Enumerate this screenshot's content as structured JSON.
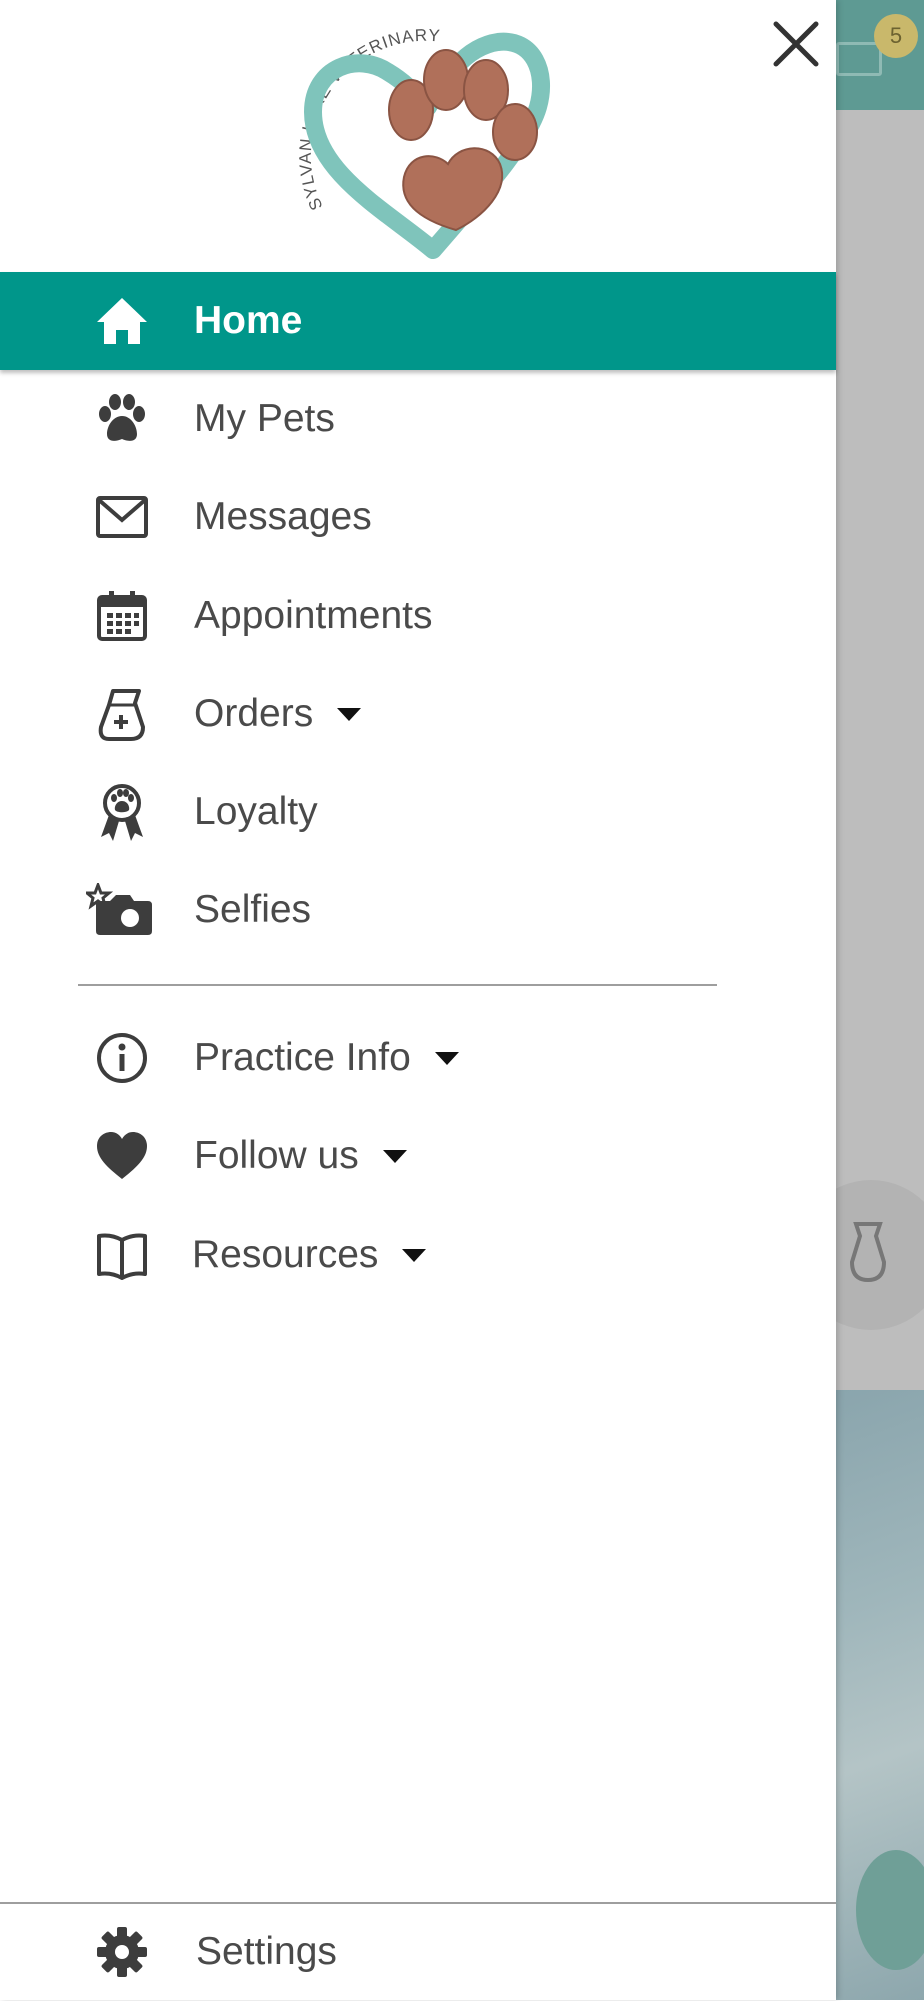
{
  "clinic": {
    "name": "SYLVAN LAKE VETERINARY CLINIC",
    "colors": {
      "teal": "#00968a",
      "heart": "#7fc4bb",
      "paw": "#b0705a"
    }
  },
  "header": {
    "close_icon": "close-icon"
  },
  "menu": {
    "primary": [
      {
        "label": "Home",
        "icon": "home-icon",
        "active": true
      },
      {
        "label": "My Pets",
        "icon": "paw-icon"
      },
      {
        "label": "Messages",
        "icon": "envelope-icon"
      },
      {
        "label": "Appointments",
        "icon": "calendar-icon"
      },
      {
        "label": "Orders",
        "icon": "medicine-bag-icon",
        "has_dropdown": true
      },
      {
        "label": "Loyalty",
        "icon": "award-ribbon-icon"
      },
      {
        "label": "Selfies",
        "icon": "camera-star-icon"
      }
    ],
    "secondary": [
      {
        "label": "Practice Info",
        "icon": "info-icon",
        "has_dropdown": true
      },
      {
        "label": "Follow us",
        "icon": "heart-icon",
        "has_dropdown": true
      },
      {
        "label": "Resources",
        "icon": "book-icon",
        "has_dropdown": true
      }
    ],
    "footer": {
      "label": "Settings",
      "icon": "gear-icon"
    }
  },
  "background_app": {
    "badge_count": "5",
    "accent": "#5e9a93"
  }
}
